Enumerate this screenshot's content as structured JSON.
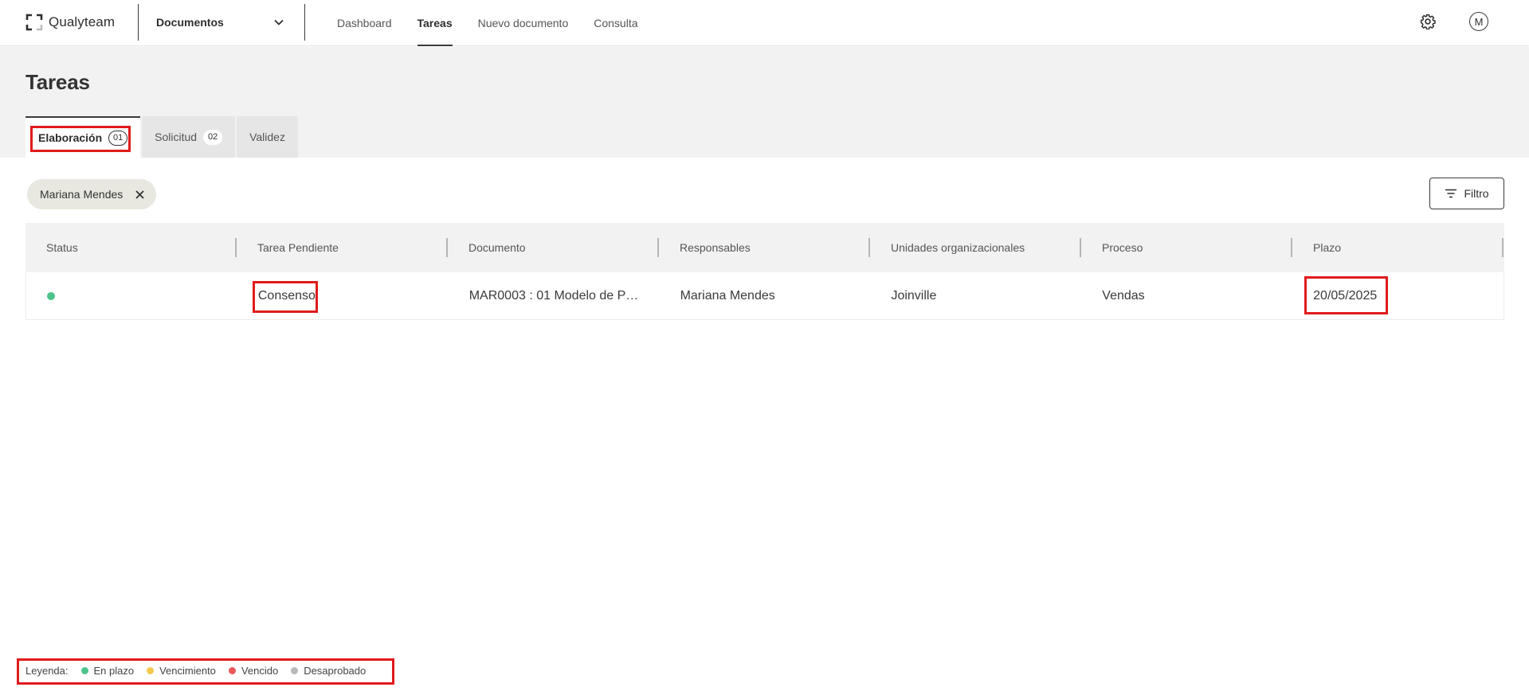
{
  "app": {
    "brand": "Qualyteam",
    "module": "Documentos",
    "nav": [
      "Dashboard",
      "Tareas",
      "Nuevo documento",
      "Consulta"
    ],
    "active_nav": "Tareas",
    "user_initial": "M",
    "icons": {
      "settings": "gear-icon",
      "module_dropdown": "chevron-down-icon"
    }
  },
  "page": {
    "title": "Tareas"
  },
  "tabs": [
    {
      "label": "Elaboración",
      "count": "01",
      "active": true
    },
    {
      "label": "Solicitud",
      "count": "02",
      "active": false
    },
    {
      "label": "Validez",
      "count": "",
      "active": false
    }
  ],
  "filters": {
    "chip_label": "Mariana Mendes",
    "button_label": "Filtro"
  },
  "table": {
    "columns": [
      "Status",
      "Tarea Pendiente",
      "Documento",
      "Responsables",
      "Unidades organizacionales",
      "Proceso",
      "Plazo"
    ],
    "rows": [
      {
        "status": "En plazo",
        "status_color": "#4cc38a",
        "task": "Consenso",
        "document": "MAR0003 : 01 Modelo de Pu...",
        "responsible": "Mariana Mendes",
        "unit": "Joinville",
        "process": "Vendas",
        "deadline": "20/05/2025"
      }
    ]
  },
  "legend": {
    "label": "Leyenda:",
    "items": [
      {
        "label": "En plazo",
        "color": "#4cc38a"
      },
      {
        "label": "Vencimiento",
        "color": "#f2c94c"
      },
      {
        "label": "Vencido",
        "color": "#eb5757"
      },
      {
        "label": "Desaprobado",
        "color": "#b8b8b8"
      }
    ]
  },
  "colors": {
    "highlight": "#e01b1b",
    "header_band": "#f2f2f2"
  }
}
